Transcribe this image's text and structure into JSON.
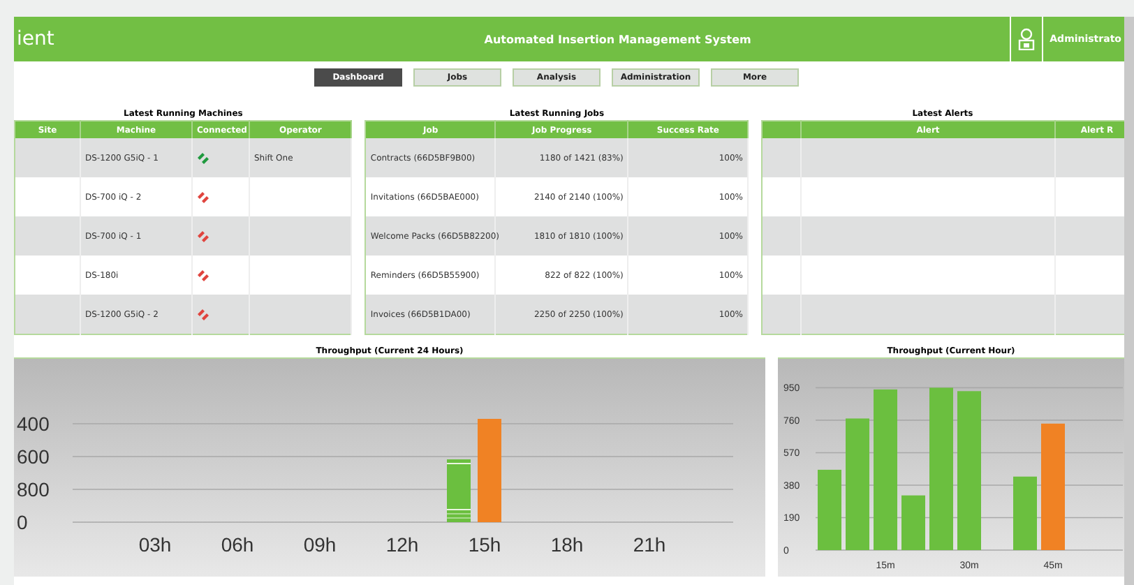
{
  "header": {
    "logo": "ient",
    "title": "Automated Insertion Management System",
    "user": "Administrato"
  },
  "tabs": [
    {
      "label": "Dashboard",
      "selected": true
    },
    {
      "label": "Jobs",
      "selected": false
    },
    {
      "label": "Analysis",
      "selected": false
    },
    {
      "label": "Administration",
      "selected": false
    },
    {
      "label": "More",
      "selected": false
    }
  ],
  "machines": {
    "title": "Latest Running Machines",
    "columns": [
      "Site",
      "Machine",
      "Connected",
      "Operator"
    ],
    "rows": [
      {
        "machine": "DS-1200 G5iQ - 1",
        "connected": true,
        "operator": "Shift One"
      },
      {
        "machine": "DS-700 iQ - 2",
        "connected": false
      },
      {
        "machine": "DS-700 iQ - 1",
        "connected": false
      },
      {
        "machine": "DS-180i",
        "connected": false
      },
      {
        "machine": "DS-1200 G5iQ - 2",
        "connected": false
      }
    ]
  },
  "jobs": {
    "title": "Latest Running Jobs",
    "columns": [
      "Job",
      "Job Progress",
      "Success Rate"
    ],
    "rows": [
      [
        "Contracts (66D5BF9B00)",
        "1180 of 1421 (83%)",
        "100%"
      ],
      [
        "Invitations (66D5BAE000)",
        "2140 of 2140 (100%)",
        "100%"
      ],
      [
        "Welcome Packs (66D5B82200)",
        "1810 of 1810 (100%)",
        "100%"
      ],
      [
        "Reminders (66D5B55900)",
        "822 of 822 (100%)",
        "100%"
      ],
      [
        "Invoices (66D5B1DA00)",
        "2250 of 2250 (100%)",
        "100%"
      ]
    ]
  },
  "alerts": {
    "title": "Latest Alerts",
    "columns": [
      "Alert",
      "Alert R"
    ]
  },
  "day_chart": {
    "title": "Throughput (Current 24 Hours)",
    "y_labels": [
      "400",
      "600",
      "800",
      "0"
    ],
    "x_labels": [
      "03h",
      "06h",
      "09h",
      "12h",
      "15h",
      "18h",
      "21h"
    ]
  },
  "hour_chart": {
    "title": "Throughput (Current Hour)",
    "chart_data": {
      "type": "bar",
      "x": [
        5,
        10,
        15,
        20,
        25,
        30,
        35,
        40,
        45
      ],
      "xlim": [
        2.5,
        57.5
      ],
      "ylim": [
        0,
        950
      ],
      "grid": true,
      "series": [
        {
          "color": "#6bbf3f",
          "values": [
            470,
            770,
            940,
            320,
            950,
            930,
            null,
            430,
            null
          ]
        },
        {
          "color": "#f08224",
          "values": [
            null,
            null,
            null,
            null,
            null,
            null,
            null,
            null,
            740
          ]
        }
      ],
      "xticks": [
        {
          "value": 15,
          "label": "15m"
        },
        {
          "value": 30,
          "label": "30m"
        },
        {
          "value": 45,
          "label": "45m"
        }
      ],
      "yticks": [
        0,
        190,
        380,
        570,
        760,
        950
      ]
    }
  }
}
